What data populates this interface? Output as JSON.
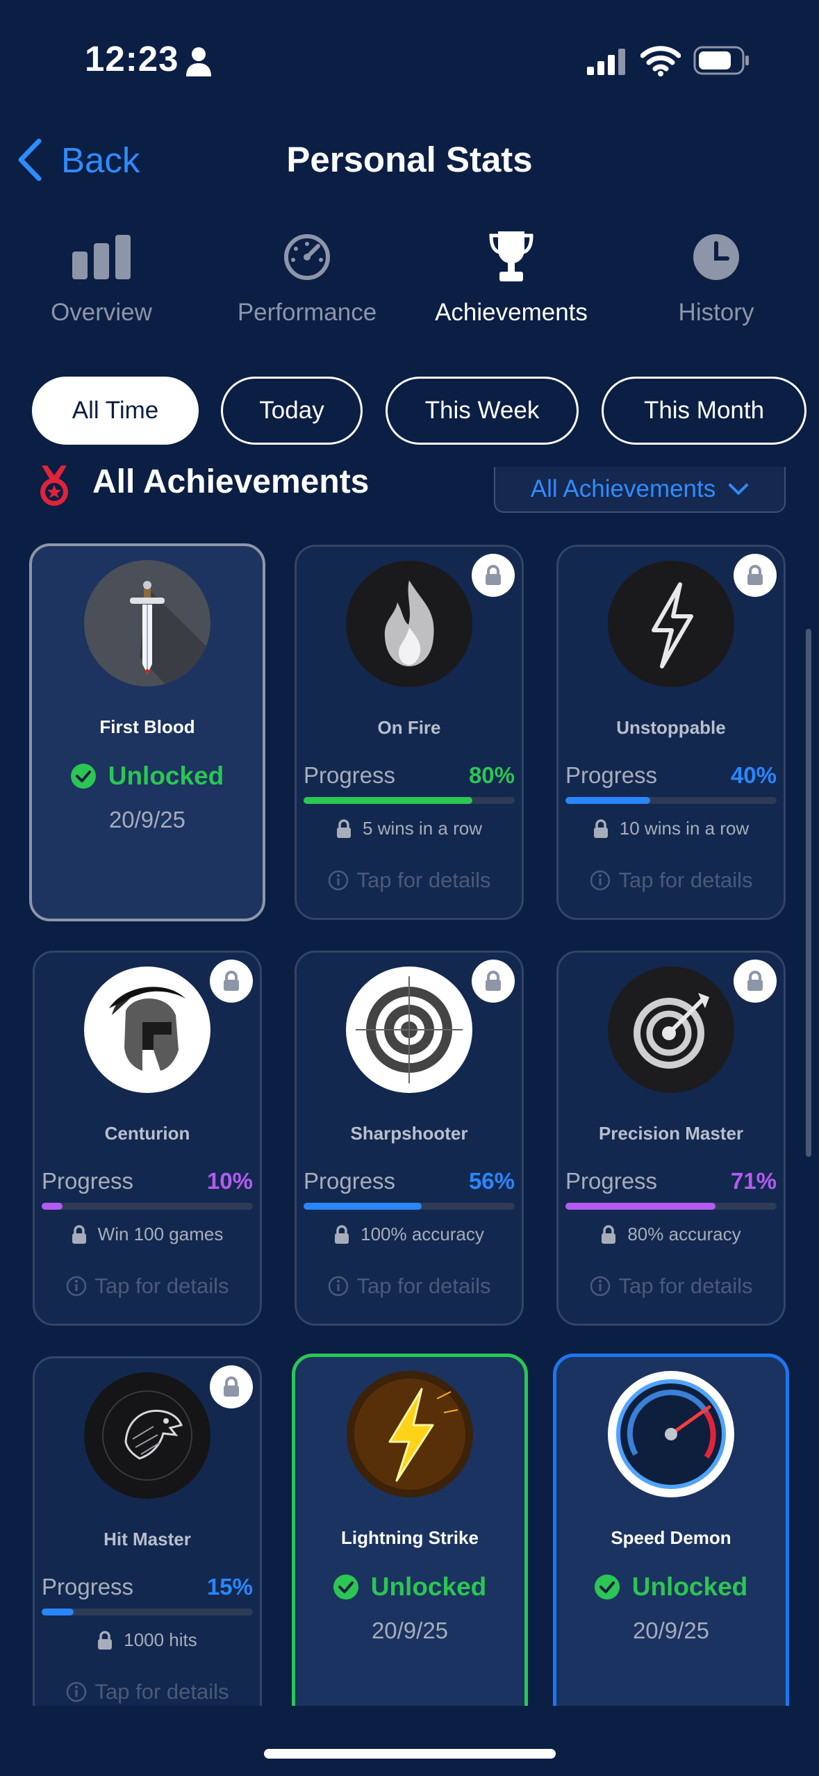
{
  "status_bar": {
    "time": "12:23"
  },
  "nav": {
    "back_label": "Back",
    "title": "Personal Stats"
  },
  "tabs": [
    {
      "label": "Overview",
      "icon": "bar-chart-icon",
      "active": false
    },
    {
      "label": "Performance",
      "icon": "speedometer-icon",
      "active": false
    },
    {
      "label": "Achievements",
      "icon": "trophy-icon",
      "active": true
    },
    {
      "label": "History",
      "icon": "clock-icon",
      "active": false
    }
  ],
  "filters": [
    {
      "label": "All Time",
      "selected": true
    },
    {
      "label": "Today",
      "selected": false
    },
    {
      "label": "This Week",
      "selected": false
    },
    {
      "label": "This Month",
      "selected": false
    }
  ],
  "section": {
    "title": "All Achievements",
    "dropdown_label": "All Achievements",
    "icon": "medal-icon"
  },
  "achievements": [
    {
      "name": "First Blood",
      "icon": "sword-icon",
      "status": "Unlocked",
      "date": "20/9/25"
    },
    {
      "name": "On Fire",
      "icon": "flame-icon",
      "progress_label": "Progress",
      "progress": "80%",
      "progress_value": 80,
      "color": "#2bc653",
      "requirement": "5 wins in a row",
      "details": "Tap for details"
    },
    {
      "name": "Unstoppable",
      "icon": "lightning-icon",
      "progress_label": "Progress",
      "progress": "40%",
      "progress_value": 40,
      "color": "#2a86ff",
      "requirement": "10 wins in a row",
      "details": "Tap for details"
    },
    {
      "name": "Centurion",
      "icon": "spartan-helmet-icon",
      "progress_label": "Progress",
      "progress": "10%",
      "progress_value": 10,
      "color": "#b25cf0",
      "requirement": "Win 100 games",
      "details": "Tap for details"
    },
    {
      "name": "Sharpshooter",
      "icon": "crosshair-target-icon",
      "progress_label": "Progress",
      "progress": "56%",
      "progress_value": 56,
      "color": "#2a86ff",
      "requirement": "100% accuracy",
      "details": "Tap for details"
    },
    {
      "name": "Precision Master",
      "icon": "dart-target-icon",
      "progress_label": "Progress",
      "progress": "71%",
      "progress_value": 71,
      "color": "#b25cf0",
      "requirement": "80% accuracy",
      "details": "Tap for details"
    },
    {
      "name": "Hit Master",
      "icon": "eagle-icon",
      "progress_label": "Progress",
      "progress": "15%",
      "progress_value": 15,
      "color": "#2a86ff",
      "requirement": "1000 hits",
      "details": "Tap for details"
    },
    {
      "name": "Lightning Strike",
      "icon": "golden-bolt-icon",
      "status": "Unlocked",
      "date": "20/9/25"
    },
    {
      "name": "Speed Demon",
      "icon": "speedometer-gauge-icon",
      "status": "Unlocked",
      "date": "20/9/25"
    }
  ]
}
